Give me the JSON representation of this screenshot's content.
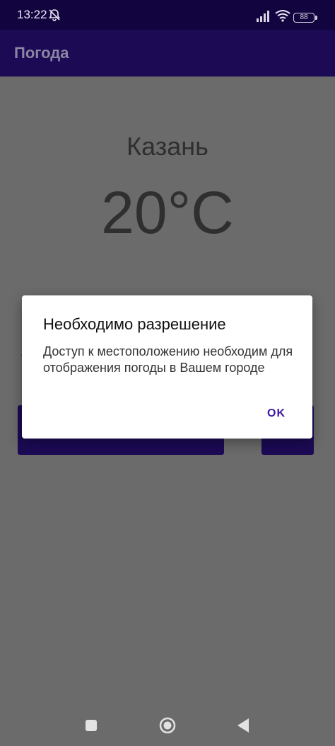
{
  "status_bar": {
    "time": "13:22",
    "battery": "88",
    "icons": [
      "bell-muted-icon",
      "signal-icon",
      "wifi-icon",
      "battery-icon"
    ]
  },
  "app_bar": {
    "title": "Погода"
  },
  "weather": {
    "city": "Казань",
    "temperature": "20°C"
  },
  "dialog": {
    "title": "Необходимо разрешение",
    "message": "Доступ к местоположению необходим для отображения погоды в Вашем городе",
    "ok_label": "OK"
  },
  "nav_bar": {
    "icons": [
      "recents-icon",
      "home-icon",
      "back-icon"
    ]
  },
  "colors": {
    "status_bar": "#12043f",
    "app_bar": "#1c0a55",
    "scrim": "#6b6b6b",
    "dialog_accent": "#3e17a3"
  }
}
